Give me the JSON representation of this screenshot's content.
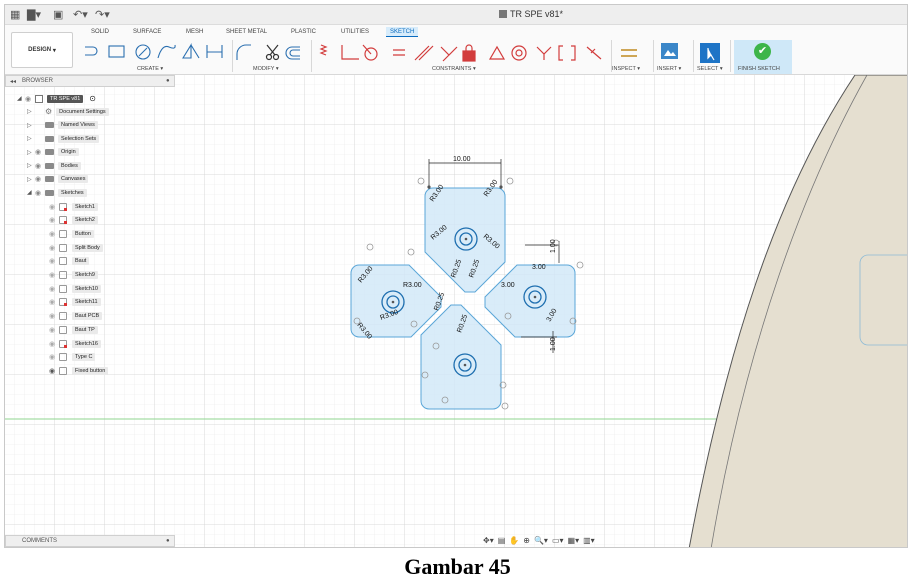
{
  "app": {
    "document_title": "TR SPE v81*"
  },
  "ribbon": {
    "tabs": [
      "SOLID",
      "SURFACE",
      "MESH",
      "SHEET METAL",
      "PLASTIC",
      "UTILITIES",
      "SKETCH"
    ],
    "active_tab": "SKETCH",
    "workspace": "DESIGN",
    "groups": {
      "create": "CREATE",
      "modify": "MODIFY",
      "constraints": "CONSTRAINTS",
      "inspect": "INSPECT",
      "insert": "INSERT",
      "select": "SELECT",
      "finish": "FINISH SKETCH"
    }
  },
  "browser": {
    "title": "BROWSER",
    "root": "TR SPE v81",
    "items": [
      "Document Settings",
      "Named Views",
      "Selection Sets",
      "Origin",
      "Bodies",
      "Canvases",
      "Sketches"
    ],
    "sketches": [
      "Sketch1",
      "Sketch2",
      "Button",
      "Split Body",
      "Baut",
      "Sketch9",
      "Sketch10",
      "Sketch11",
      "Baut PCB",
      "Baut TP",
      "Sketch16",
      "Type C",
      "Fixed button"
    ]
  },
  "comments": {
    "title": "COMMENTS"
  },
  "sketch": {
    "dim_width": "10.00",
    "dims": [
      "R3.00",
      "R3.00",
      "R3.00",
      "R3.00",
      "R3.00",
      "R3.00",
      "R3.00",
      "R3.00",
      "R0.25",
      "R0.25",
      "R0.25",
      "R0.25",
      "3.00",
      "1.00",
      "1.00",
      "3.00",
      "3.00"
    ]
  },
  "caption": "Gambar 45",
  "colors": {
    "accent": "#0a6bbf",
    "sketch_fill": "#cfe7f7",
    "sketch_line": "#5aa6d8",
    "finish": "#3db54a",
    "body": "#e5dfd0"
  }
}
